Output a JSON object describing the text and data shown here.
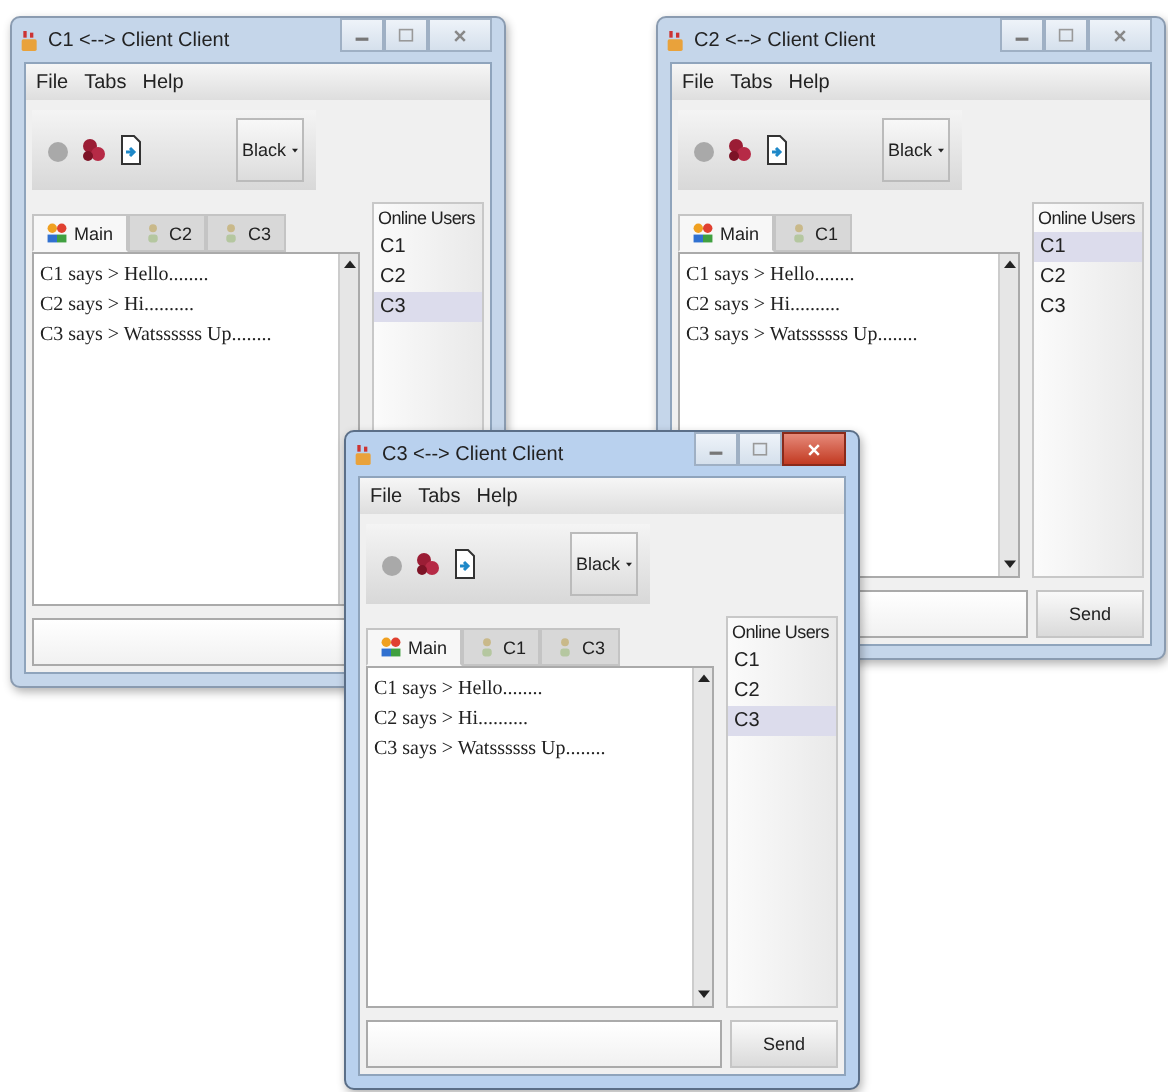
{
  "windows": [
    {
      "title": "C1 <--> Client Client",
      "active": false,
      "menu": [
        "File",
        "Tabs",
        "Help"
      ],
      "color_choice": "Black",
      "tabs": [
        {
          "label": "Main",
          "kind": "main",
          "selected": true
        },
        {
          "label": "C2",
          "kind": "user",
          "selected": false
        },
        {
          "label": "C3",
          "kind": "user",
          "selected": false
        }
      ],
      "messages": [
        "C1 says > Hello........",
        "C2 says > Hi..........",
        "C3 says > Watssssss Up........"
      ],
      "online_users": {
        "heading": "Online Users",
        "users": [
          {
            "name": "C1",
            "selected": false
          },
          {
            "name": "C2",
            "selected": false
          },
          {
            "name": "C3",
            "selected": true
          }
        ]
      }
    },
    {
      "title": "C2 <--> Client Client",
      "active": false,
      "menu": [
        "File",
        "Tabs",
        "Help"
      ],
      "color_choice": "Black",
      "tabs": [
        {
          "label": "Main",
          "kind": "main",
          "selected": true
        },
        {
          "label": "C1",
          "kind": "user",
          "selected": false
        }
      ],
      "messages": [
        "C1 says > Hello........",
        "C2 says > Hi..........",
        "C3 says > Watssssss Up........"
      ],
      "online_users": {
        "heading": "Online Users",
        "users": [
          {
            "name": "C1",
            "selected": true
          },
          {
            "name": "C2",
            "selected": false
          },
          {
            "name": "C3",
            "selected": false
          }
        ]
      },
      "send_button": "Send"
    },
    {
      "title": "C3 <--> Client Client",
      "active": true,
      "menu": [
        "File",
        "Tabs",
        "Help"
      ],
      "color_choice": "Black",
      "tabs": [
        {
          "label": "Main",
          "kind": "main",
          "selected": true
        },
        {
          "label": "C1",
          "kind": "user",
          "selected": false
        },
        {
          "label": "C3",
          "kind": "user",
          "selected": false
        }
      ],
      "messages": [
        "C1 says > Hello........",
        "C2 says > Hi..........",
        "C3 says > Watssssss Up........"
      ],
      "online_users": {
        "heading": "Online Users",
        "users": [
          {
            "name": "C1",
            "selected": false
          },
          {
            "name": "C2",
            "selected": false
          },
          {
            "name": "C3",
            "selected": true
          }
        ]
      },
      "send_button": "Send"
    }
  ]
}
